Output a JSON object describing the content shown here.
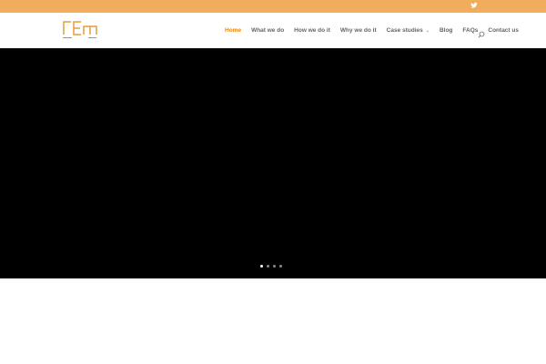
{
  "brand": {
    "logo_text": "rEm",
    "accent": "#f0ad5c"
  },
  "topbar": {
    "icons": [
      "twitter-icon"
    ]
  },
  "nav": {
    "items": [
      {
        "label": "Home",
        "active": true
      },
      {
        "label": "What we do"
      },
      {
        "label": "How we do it"
      },
      {
        "label": "Why we do it"
      },
      {
        "label": "Case studies",
        "has_dropdown": true
      },
      {
        "label": "Blog"
      },
      {
        "label": "FAQs"
      },
      {
        "label": "Contact us"
      }
    ]
  },
  "slider": {
    "slide_count": 4,
    "active_slide": 1
  }
}
